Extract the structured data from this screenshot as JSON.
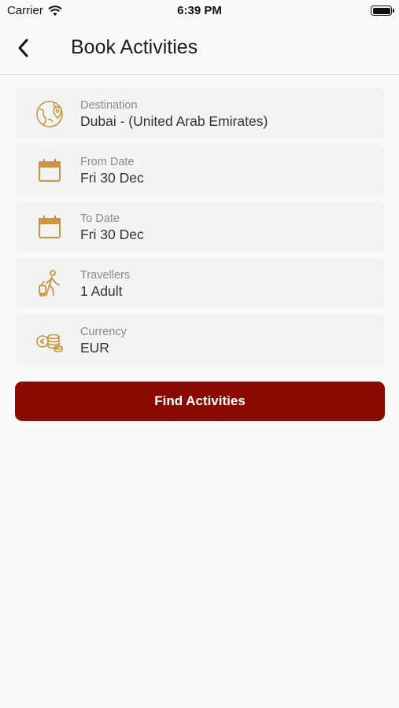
{
  "status_bar": {
    "carrier": "Carrier",
    "time": "6:39 PM"
  },
  "header": {
    "title": "Book Activities"
  },
  "fields": [
    {
      "label": "Destination",
      "value": "Dubai - (United Arab Emirates)",
      "icon": "globe-pin-icon"
    },
    {
      "label": "From Date",
      "value": "Fri 30 Dec",
      "icon": "calendar-icon"
    },
    {
      "label": "To Date",
      "value": "Fri 30 Dec",
      "icon": "calendar-icon"
    },
    {
      "label": "Travellers",
      "value": "1 Adult",
      "icon": "traveller-luggage-icon"
    },
    {
      "label": "Currency",
      "value": "EUR",
      "icon": "coins-icon"
    }
  ],
  "find_button": {
    "label": "Find Activities"
  },
  "colors": {
    "accent": "#c8963f",
    "button": "#8b0a00",
    "row_bg": "#f3f3f3"
  }
}
